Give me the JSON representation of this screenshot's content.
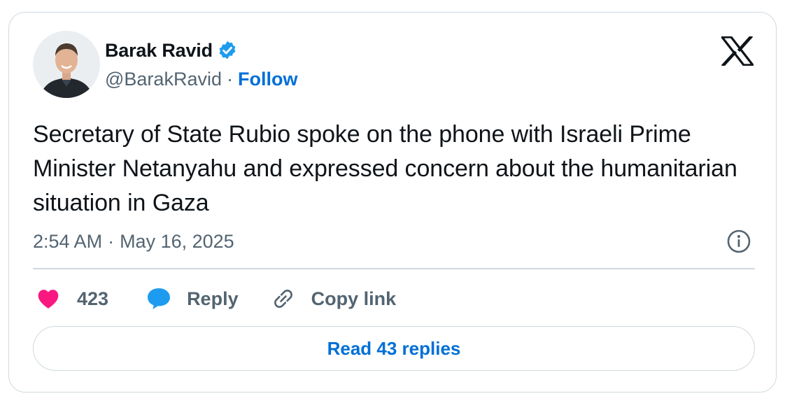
{
  "author": {
    "name": "Barak Ravid",
    "handle": "@BarakRavid",
    "separator": "·",
    "follow_label": "Follow",
    "verified": true
  },
  "tweet": {
    "text": "Secretary of State Rubio spoke on the phone with Israeli Prime Minister Netanyahu and expressed concern about the humanitarian situation in Gaza",
    "time": "2:54 AM",
    "date_separator": "·",
    "date": "May 16, 2025"
  },
  "actions": {
    "like_count": "423",
    "reply_label": "Reply",
    "copy_link_label": "Copy link"
  },
  "replies_button": {
    "label": "Read 43 replies"
  },
  "icons": {
    "verified": "verified-badge-icon",
    "brand": "x-logo-icon",
    "info": "info-icon",
    "like": "heart-icon",
    "reply": "speech-bubble-icon",
    "copy_link": "link-icon"
  },
  "colors": {
    "accent": "#006fd6",
    "verified": "#1d9bf0",
    "like": "#f91880",
    "secondary_text": "#536471",
    "border": "#cfd9de"
  }
}
